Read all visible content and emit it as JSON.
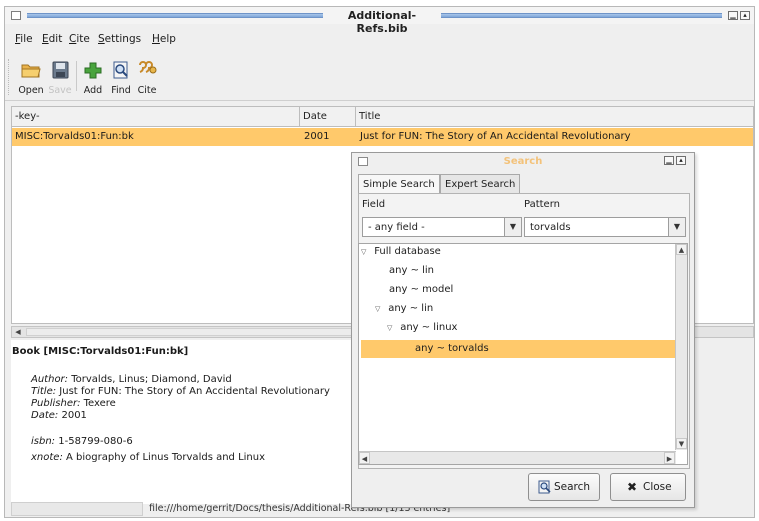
{
  "window": {
    "title": "Additional-Refs.bib",
    "controls": [
      "minimize",
      "maximize"
    ]
  },
  "menu": [
    {
      "label": "File",
      "mnemonic": "F",
      "rest": "ile"
    },
    {
      "label": "Edit",
      "mnemonic": "E",
      "rest": "dit"
    },
    {
      "label": "Cite",
      "mnemonic": "C",
      "rest": "ite"
    },
    {
      "label": "Settings",
      "mnemonic": "S",
      "rest": "ettings"
    },
    {
      "label": "Help",
      "mnemonic": "H",
      "rest": "elp"
    }
  ],
  "toolbar": {
    "open": "Open",
    "save": "Save",
    "add": "Add",
    "find": "Find",
    "cite": "Cite"
  },
  "table": {
    "columns": [
      "-key-",
      "Date",
      "Title"
    ],
    "rows": [
      {
        "key": "MISC:Torvalds01:Fun:bk",
        "date": "2001",
        "title": "Just for FUN: The Story of An Accidental Revolutionary"
      }
    ]
  },
  "preview": {
    "header": "Book [MISC:Torvalds01:Fun:bk]",
    "fields": [
      {
        "label": "Author:",
        "value": "Torvalds, Linus; Diamond, David"
      },
      {
        "label": "Title:",
        "value": "Just for FUN: The Story of An Accidental Revolutionary"
      },
      {
        "label": "Publisher:",
        "value": "Texere"
      },
      {
        "label": "Date:",
        "value": "2001"
      },
      {
        "label": "isbn:",
        "value": "1-58799-080-6"
      },
      {
        "label": "xnote:",
        "value": "A biography of Linus Torvalds and Linux"
      }
    ]
  },
  "status": {
    "text": "file:///home/gerrit/Docs/thesis/Additional-Refs.bib [1/13 entries]"
  },
  "search_dialog": {
    "title": "Search",
    "tabs": [
      "Simple Search",
      "Expert Search"
    ],
    "active_tab": "Simple Search",
    "field_label": "Field",
    "pattern_label": "Pattern",
    "field_value": "- any field -",
    "pattern_value": "torvalds",
    "tree": [
      {
        "label": "Full database",
        "expanded": true,
        "level": 0
      },
      {
        "label": "any ~ lin",
        "level": 1
      },
      {
        "label": "any ~ model",
        "level": 1
      },
      {
        "label": "any ~ lin",
        "expanded": true,
        "level": 1
      },
      {
        "label": "any ~ linux",
        "expanded": true,
        "level": 2
      },
      {
        "label": "any ~ torvalds",
        "level": 3,
        "selected": true
      }
    ],
    "search_button": "Search",
    "close_button": "Close"
  },
  "colors": {
    "selection": "#ffc96b",
    "title_stripe": "#7fa6d8",
    "dialog_title": "#f3c27a"
  }
}
